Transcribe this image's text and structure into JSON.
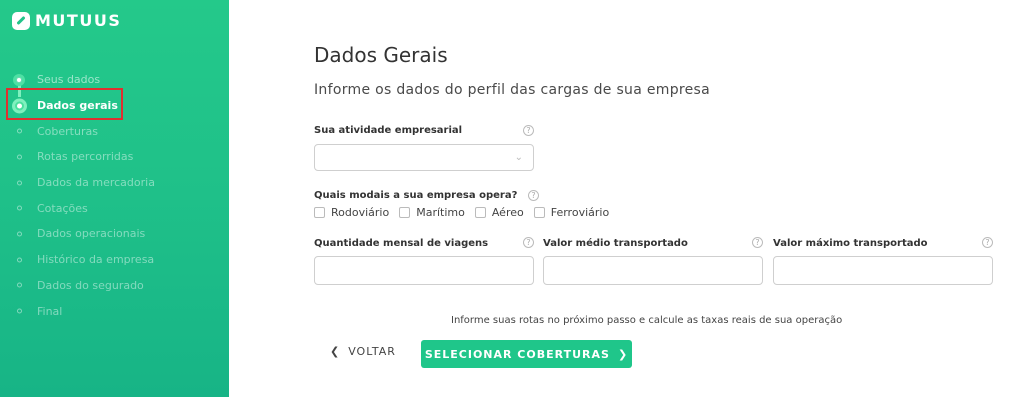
{
  "brand": {
    "name": "mutuus"
  },
  "sidebar": {
    "steps": [
      {
        "label": "Seus dados",
        "state": "done"
      },
      {
        "label": "Dados gerais",
        "state": "active"
      },
      {
        "label": "Coberturas",
        "state": "pending"
      },
      {
        "label": "Rotas percorridas",
        "state": "pending"
      },
      {
        "label": "Dados da mercadoria",
        "state": "pending"
      },
      {
        "label": "Cotações",
        "state": "pending"
      },
      {
        "label": "Dados operacionais",
        "state": "pending"
      },
      {
        "label": "Histórico da empresa",
        "state": "pending"
      },
      {
        "label": "Dados do segurado",
        "state": "pending"
      },
      {
        "label": "Final",
        "state": "pending"
      }
    ]
  },
  "main": {
    "title": "Dados Gerais",
    "subtitle": "Informe os dados do perfil das cargas de sua empresa",
    "atividade": {
      "label": "Sua atividade empresarial",
      "help": "?",
      "value": ""
    },
    "modais": {
      "label": "Quais modais a sua empresa opera?",
      "help": "?",
      "options": [
        "Rodoviário",
        "Marítimo",
        "Aéreo",
        "Ferroviário"
      ]
    },
    "viagens": {
      "label": "Quantidade mensal de viagens",
      "help": "?",
      "value": ""
    },
    "valor_medio": {
      "label": "Valor médio transportado",
      "help": "?",
      "value": ""
    },
    "valor_maximo": {
      "label": "Valor máximo transportado",
      "help": "?",
      "value": ""
    },
    "info": "Informe suas rotas no próximo passo e calcule as taxas reais de sua operação",
    "back_label": "VOLTAR",
    "next_label": "SELECIONAR COBERTURAS"
  },
  "colors": {
    "accent": "#1fc68a",
    "highlight": "#e03030"
  }
}
